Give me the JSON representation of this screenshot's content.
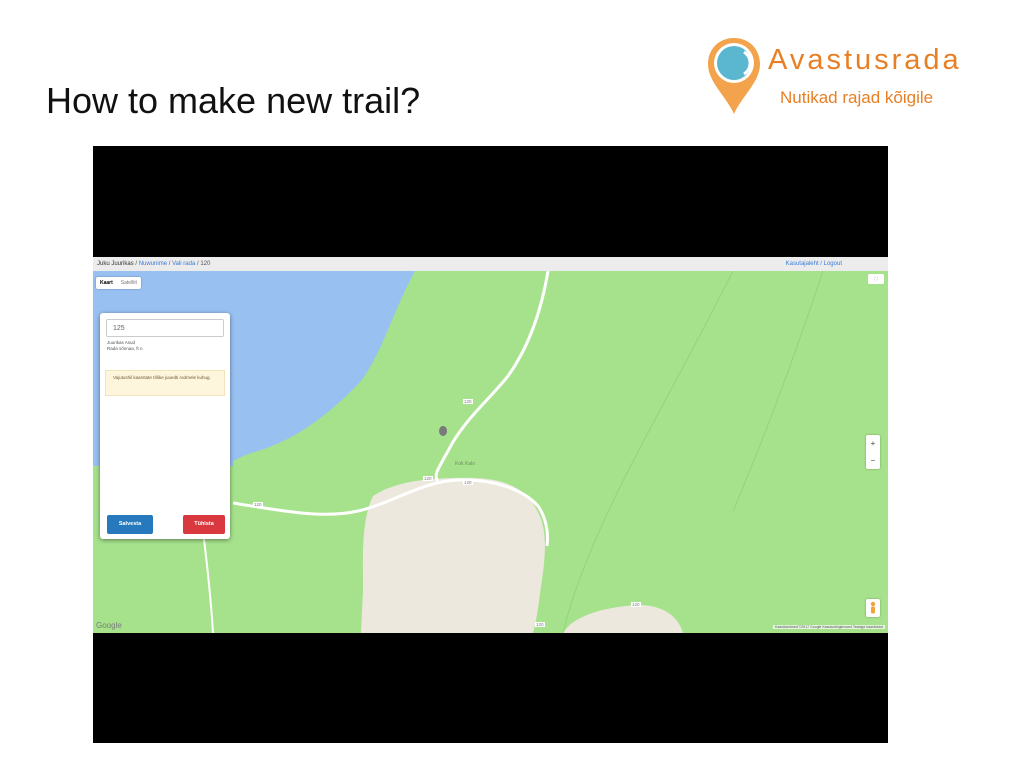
{
  "slide": {
    "title": "How to make new trail?"
  },
  "logo": {
    "name": "Avastusrada",
    "tagline": "Nutikad rajad kõigile",
    "color": "#e87f24",
    "pin_color": "#f3a34b",
    "pin_inner_color": "#5bb6cf"
  },
  "app": {
    "breadcrumb": {
      "user": "Juku Juurikas",
      "sep1": " / ",
      "link1": "Nuwunime",
      "sep2": " / ",
      "link2": "Vali rada",
      "sep3": " / ",
      "current": "120"
    },
    "top_links": "Kasutajaleht / Logout",
    "map_tabs": [
      {
        "label": "Kaart",
        "active": true
      },
      {
        "label": "Satelliit",
        "active": false
      }
    ],
    "fullscreen_label": "⛶",
    "panel": {
      "input_value": "125",
      "meta_lines": [
        "Juurikas Asud",
        "Rada sõnnaa, ft n"
      ],
      "hint": "Vajutushil kaarstate tõlike juuedti rodrnele kuhug.",
      "save_label": "Salvesta",
      "cancel_label": "Tühista"
    },
    "zoom": {
      "in": "+",
      "out": "−"
    },
    "map_labels": {
      "place": "Kok Kalo"
    },
    "road_labels": [
      "120",
      "120",
      "120",
      "120",
      "120",
      "120"
    ],
    "google": "Google",
    "footer": "Kaardiandmed ©2017 Google  Kasutustingimused  Teatage kaardiviast"
  },
  "colors": {
    "water": "#98c1f2",
    "land": "#a6e28c",
    "clearing": "#ece8dd",
    "save": "#2679bd",
    "cancel": "#d9383f"
  }
}
